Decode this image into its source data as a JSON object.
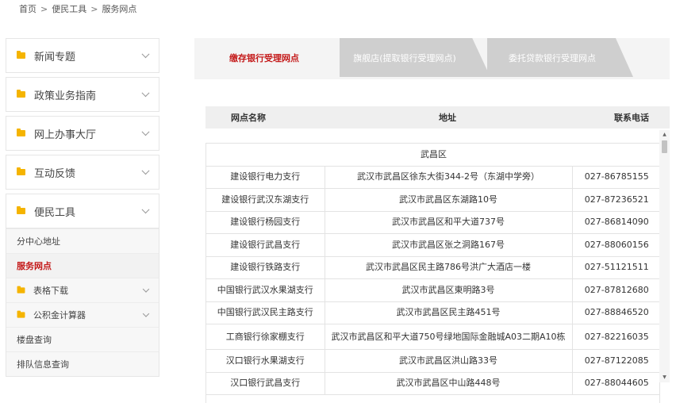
{
  "breadcrumb": [
    "首页",
    "便民工具",
    "服务网点"
  ],
  "breadcrumb_sep": ">",
  "sidebar": {
    "items": [
      {
        "label": "新闻专题"
      },
      {
        "label": "政策业务指南"
      },
      {
        "label": "网上办事大厅"
      },
      {
        "label": "互动反馈"
      },
      {
        "label": "便民工具"
      }
    ],
    "sub_items": [
      {
        "label": "分中心地址"
      },
      {
        "label": "服务网点"
      },
      {
        "label": "表格下载"
      },
      {
        "label": "公积金计算器"
      },
      {
        "label": "楼盘查询"
      },
      {
        "label": "排队信息查询"
      }
    ]
  },
  "tabs": [
    {
      "label": "缴存银行受理网点"
    },
    {
      "label": "旗舰店(提取银行受理网点)"
    },
    {
      "label": "委托贷款银行受理网点"
    }
  ],
  "table": {
    "headers": [
      "网点名称",
      "地址",
      "联系电话"
    ],
    "district": "武昌区",
    "rows": [
      [
        "建设银行电力支行",
        "武汉市武昌区徐东大街344-2号（东湖中学旁）",
        "027-86785155"
      ],
      [
        "建设银行武汉东湖支行",
        "武汉市武昌区东湖路10号",
        "027-87236521"
      ],
      [
        "建设银行杨园支行",
        "武汉市武昌区和平大道737号",
        "027-86814090"
      ],
      [
        "建设银行武昌支行",
        "武汉市武昌区张之洞路167号",
        "027-88060156"
      ],
      [
        "建设银行铁路支行",
        "武汉市武昌区民主路786号洪广大酒店一楼",
        "027-51121511"
      ],
      [
        "中国银行武汉水果湖支行",
        "武汉市武昌区東明路3号",
        "027-87812680"
      ],
      [
        "中国银行武汉民主路支行",
        "武汉市武昌区民主路451号",
        "027-88846520"
      ],
      [
        "工商银行徐家棚支行",
        "武汉市武昌区和平大道750号绿地国际金融城A03二期A10栋",
        "027-82216035"
      ],
      [
        "汉口银行水果湖支行",
        "武汉市武昌区洪山路33号",
        "027-87122085"
      ],
      [
        "汉口银行武昌支行",
        "武汉市武昌区中山路448号",
        "027-88044605"
      ]
    ]
  },
  "scrollbar": {
    "up_icon": "▲",
    "down_icon": "▼"
  },
  "colors": {
    "accent": "#c41a1a",
    "folder": "#f5b400",
    "tab_inactive": "#cfcfcf"
  }
}
